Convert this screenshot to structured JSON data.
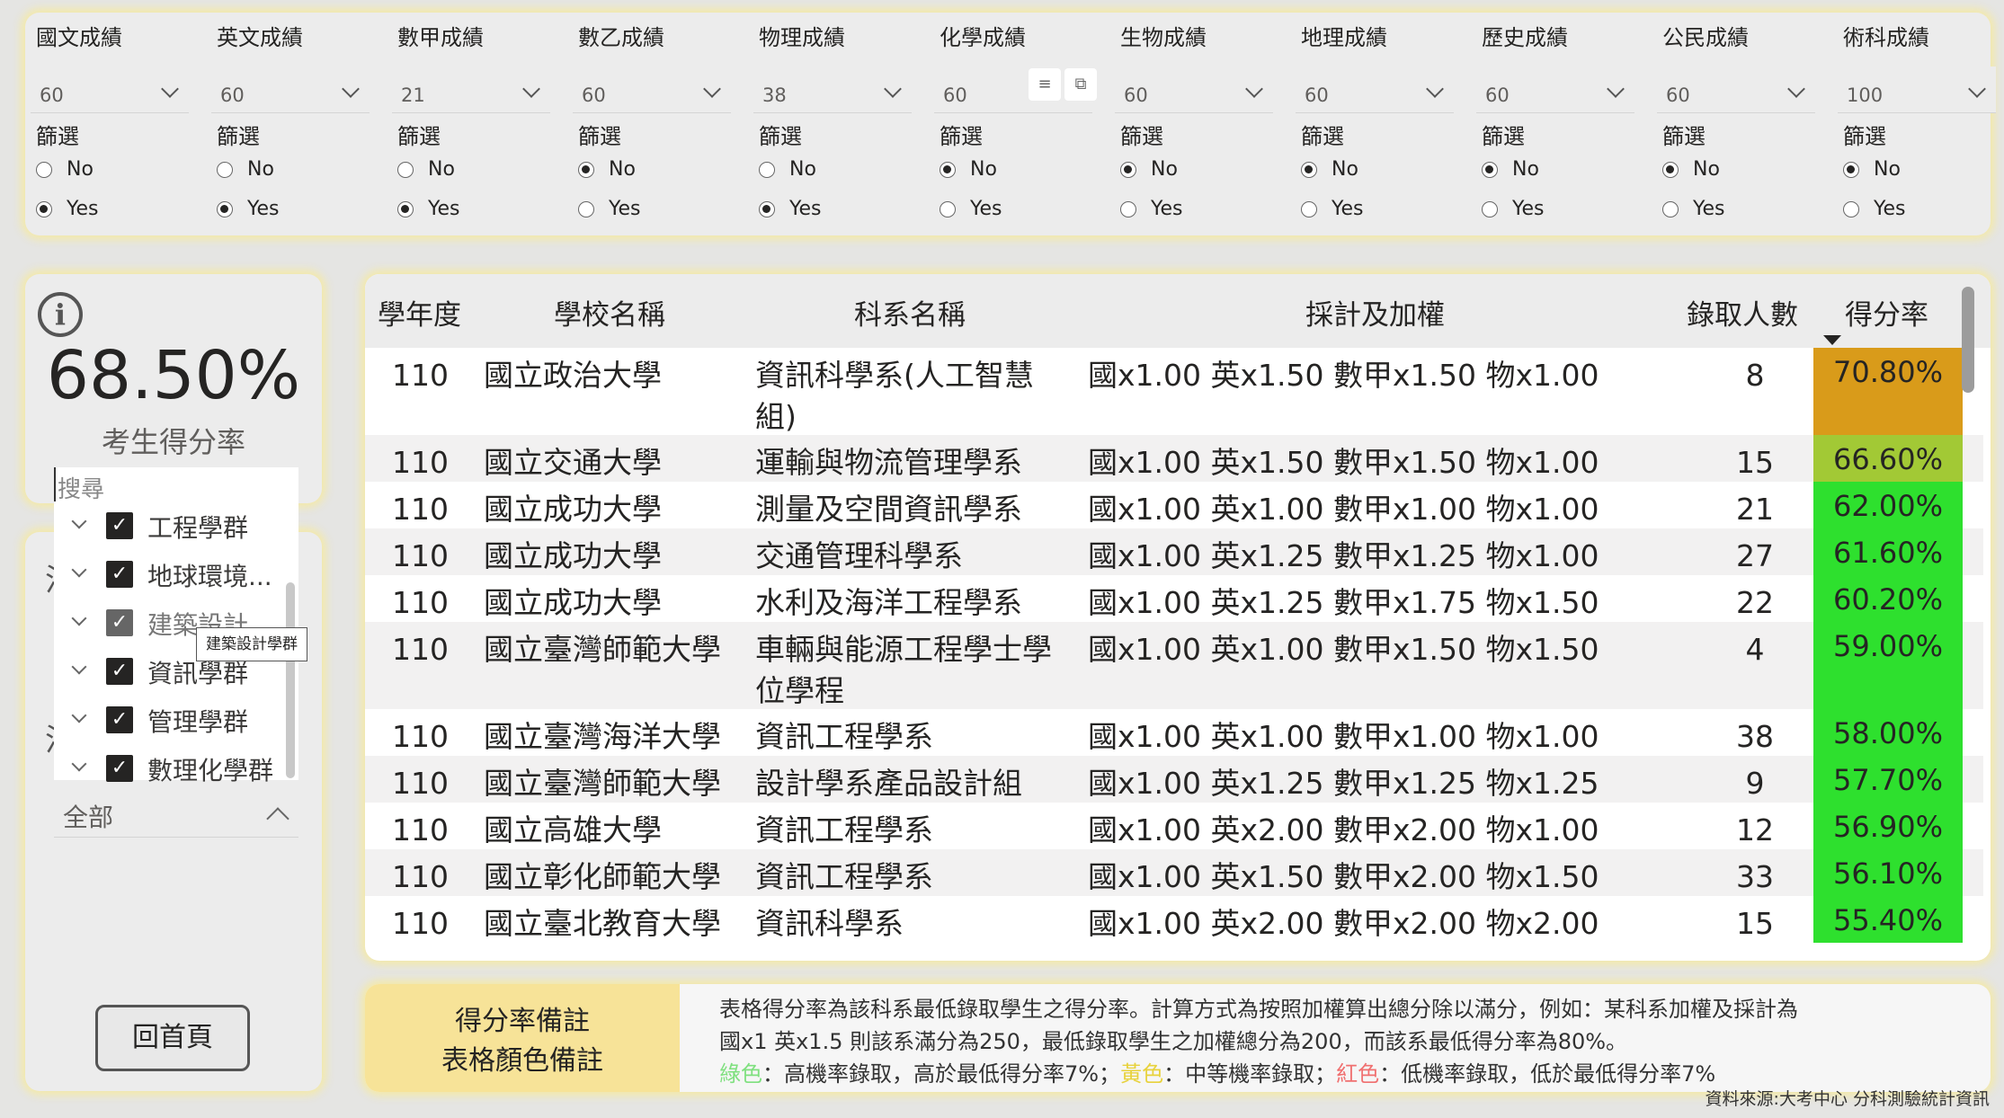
{
  "filters": [
    {
      "title": "國文成績",
      "value": "60",
      "selected": "Yes"
    },
    {
      "title": "英文成績",
      "value": "60",
      "selected": "Yes"
    },
    {
      "title": "數甲成績",
      "value": "21",
      "selected": "Yes"
    },
    {
      "title": "數乙成績",
      "value": "60",
      "selected": "No"
    },
    {
      "title": "物理成績",
      "value": "38",
      "selected": "Yes"
    },
    {
      "title": "化學成績",
      "value": "60",
      "selected": "No"
    },
    {
      "title": "生物成績",
      "value": "60",
      "selected": "No"
    },
    {
      "title": "地理成績",
      "value": "60",
      "selected": "No"
    },
    {
      "title": "歷史成績",
      "value": "60",
      "selected": "No"
    },
    {
      "title": "公民成績",
      "value": "60",
      "selected": "No"
    },
    {
      "title": "術科成績",
      "value": "100",
      "selected": "No"
    }
  ],
  "filter_labels": {
    "screen": "篩選",
    "no": "No",
    "yes": "Yes"
  },
  "score": {
    "value": "68.50%",
    "label": "考生得分率",
    "info_glyph": "i"
  },
  "slicer": {
    "search_placeholder": "搜尋",
    "items": [
      {
        "label": "工程學群",
        "checked": true
      },
      {
        "label": "地球環境...",
        "checked": true
      },
      {
        "label": "建築設計...",
        "checked": true
      },
      {
        "label": "資訊學群",
        "checked": true
      },
      {
        "label": "管理學群",
        "checked": true
      },
      {
        "label": "數理化學群",
        "checked": true
      }
    ],
    "tooltip": "建築設計學群",
    "all_label": "全部",
    "ghost_char": "注"
  },
  "home_button": "回首頁",
  "table": {
    "columns": [
      "學年度",
      "學校名稱",
      "科系名稱",
      "採計及加權",
      "錄取人數",
      "得分率"
    ],
    "rows": [
      {
        "year": "110",
        "school": "國立政治大學",
        "dept": "資訊科學系(人工智慧組)",
        "weights": "國x1.00 英x1.50 數甲x1.50 物x1.00",
        "count": "8",
        "rate": "70.80%",
        "color": "#d99b1a"
      },
      {
        "year": "110",
        "school": "國立交通大學",
        "dept": "運輸與物流管理學系",
        "weights": "國x1.00 英x1.50 數甲x1.50 物x1.00",
        "count": "15",
        "rate": "66.60%",
        "color": "#a2c935"
      },
      {
        "year": "110",
        "school": "國立成功大學",
        "dept": "測量及空間資訊學系",
        "weights": "國x1.00 英x1.00 數甲x1.00 物x1.00",
        "count": "21",
        "rate": "62.00%",
        "color": "#2ee02e"
      },
      {
        "year": "110",
        "school": "國立成功大學",
        "dept": "交通管理科學系",
        "weights": "國x1.00 英x1.25 數甲x1.25 物x1.00",
        "count": "27",
        "rate": "61.60%",
        "color": "#2ee02e"
      },
      {
        "year": "110",
        "school": "國立成功大學",
        "dept": "水利及海洋工程學系",
        "weights": "國x1.00 英x1.25 數甲x1.75 物x1.50",
        "count": "22",
        "rate": "60.20%",
        "color": "#2ee02e"
      },
      {
        "year": "110",
        "school": "國立臺灣師範大學",
        "dept": "車輛與能源工程學士學位學程",
        "weights": "國x1.00 英x1.00 數甲x1.50 物x1.50",
        "count": "4",
        "rate": "59.00%",
        "color": "#2ee02e"
      },
      {
        "year": "110",
        "school": "國立臺灣海洋大學",
        "dept": "資訊工程學系",
        "weights": "國x1.00 英x1.00 數甲x1.00 物x1.00",
        "count": "38",
        "rate": "58.00%",
        "color": "#2ee02e"
      },
      {
        "year": "110",
        "school": "國立臺灣師範大學",
        "dept": "設計學系產品設計組",
        "weights": "國x1.00 英x1.25 數甲x1.25 物x1.25",
        "count": "9",
        "rate": "57.70%",
        "color": "#2ee02e"
      },
      {
        "year": "110",
        "school": "國立高雄大學",
        "dept": "資訊工程學系",
        "weights": "國x1.00 英x2.00 數甲x2.00 物x1.00",
        "count": "12",
        "rate": "56.90%",
        "color": "#2ee02e"
      },
      {
        "year": "110",
        "school": "國立彰化師範大學",
        "dept": "資訊工程學系",
        "weights": "國x1.00 英x1.50 數甲x2.00 物x1.50",
        "count": "33",
        "rate": "56.10%",
        "color": "#2ee02e"
      },
      {
        "year": "110",
        "school": "國立臺北教育大學",
        "dept": "資訊科學系",
        "weights": "國x1.00 英x2.00 數甲x2.00 物x2.00",
        "count": "15",
        "rate": "55.40%",
        "color": "#2ee02e"
      }
    ]
  },
  "notes": {
    "title_line1": "得分率備註",
    "title_line2": "表格顏色備註",
    "line1": "表格得分率為該科系最低錄取學生之得分率。計算方式為按照加權算出總分除以滿分，例如：某科系加權及採計為",
    "line2": "國x1 英x1.5 則該系滿分為250，最低錄取學生之加權總分為200，而該系最低得分率為80%。",
    "green_word": "綠色",
    "green_text": "：高機率錄取，高於最低得分率7%；",
    "yellow_word": "黃色",
    "yellow_text": "：中等機率錄取；",
    "red_word": "紅色",
    "red_text": "：低機率錄取，低於最低得分率7%"
  },
  "source": "資料來源:大考中心 分科測驗統計資訊",
  "icons": [
    "chevron-down-icon",
    "info-icon",
    "checkbox-checked-icon",
    "sort-desc-icon",
    "filter-icon",
    "focus-mode-icon",
    "chevron-up-icon"
  ]
}
